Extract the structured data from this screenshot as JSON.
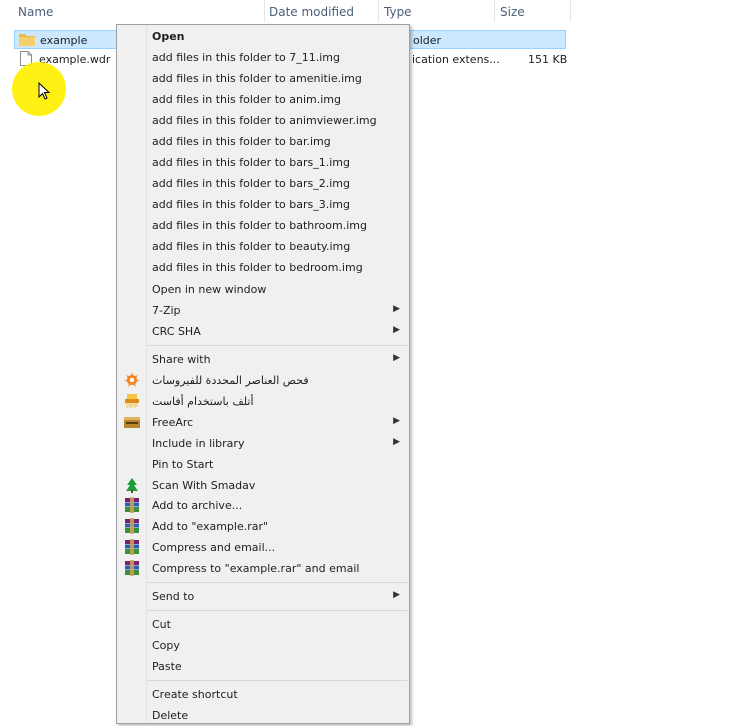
{
  "header": {
    "name": "Name",
    "date_modified": "Date modified",
    "type": "Type",
    "size": "Size"
  },
  "files": [
    {
      "name": "example",
      "type": "older",
      "size": "",
      "selected": true,
      "icon": "folder-icon"
    },
    {
      "name": "example.wdr",
      "type": "ication extens...",
      "size": "151 KB",
      "selected": false,
      "icon": "file-icon"
    }
  ],
  "menu": {
    "items": [
      {
        "label": "Open",
        "bold": true
      },
      {
        "label": "add files in this folder to 7_11.img"
      },
      {
        "label": "add files in this folder to amenitie.img"
      },
      {
        "label": "add files in this folder to anim.img"
      },
      {
        "label": "add files in this folder to animviewer.img"
      },
      {
        "label": "add files in this folder to bar.img"
      },
      {
        "label": "add files in this folder to bars_1.img"
      },
      {
        "label": "add files in this folder to bars_2.img"
      },
      {
        "label": "add files in this folder to bars_3.img"
      },
      {
        "label": "add files in this folder to bathroom.img"
      },
      {
        "label": "add files in this folder to beauty.img"
      },
      {
        "label": "add files in this folder to bedroom.img"
      },
      {
        "label": "Open in new window"
      },
      {
        "label": "7-Zip",
        "submenu": true
      },
      {
        "label": "CRC SHA",
        "submenu": true
      },
      {
        "label": "Share with",
        "submenu": true
      },
      {
        "label": "فحص العناصر المحددة للفيروسات",
        "icon": "avast-icon"
      },
      {
        "label": "أتلف باستخدام أفاست",
        "icon": "shredder-icon"
      },
      {
        "label": "FreeArc",
        "submenu": true,
        "icon": "freearc-icon"
      },
      {
        "label": "Include in library",
        "submenu": true
      },
      {
        "label": "Pin to Start"
      },
      {
        "label": "Scan With Smadav",
        "icon": "smadav-icon"
      },
      {
        "label": "Add to archive...",
        "icon": "winrar-icon"
      },
      {
        "label": "Add to \"example.rar\"",
        "icon": "winrar-icon"
      },
      {
        "label": "Compress and email...",
        "icon": "winrar-icon"
      },
      {
        "label": "Compress to \"example.rar\" and email",
        "icon": "winrar-icon"
      },
      {
        "label": "Send to",
        "submenu": true
      },
      {
        "label": "Cut"
      },
      {
        "label": "Copy"
      },
      {
        "label": "Paste"
      },
      {
        "label": "Create shortcut"
      },
      {
        "label": "Delete"
      }
    ],
    "submenu_arrow": "▶"
  },
  "colors": {
    "selection_bg": "#cce8ff",
    "menu_bg": "#f0f0f0",
    "cursor_highlight": "#fff000"
  }
}
